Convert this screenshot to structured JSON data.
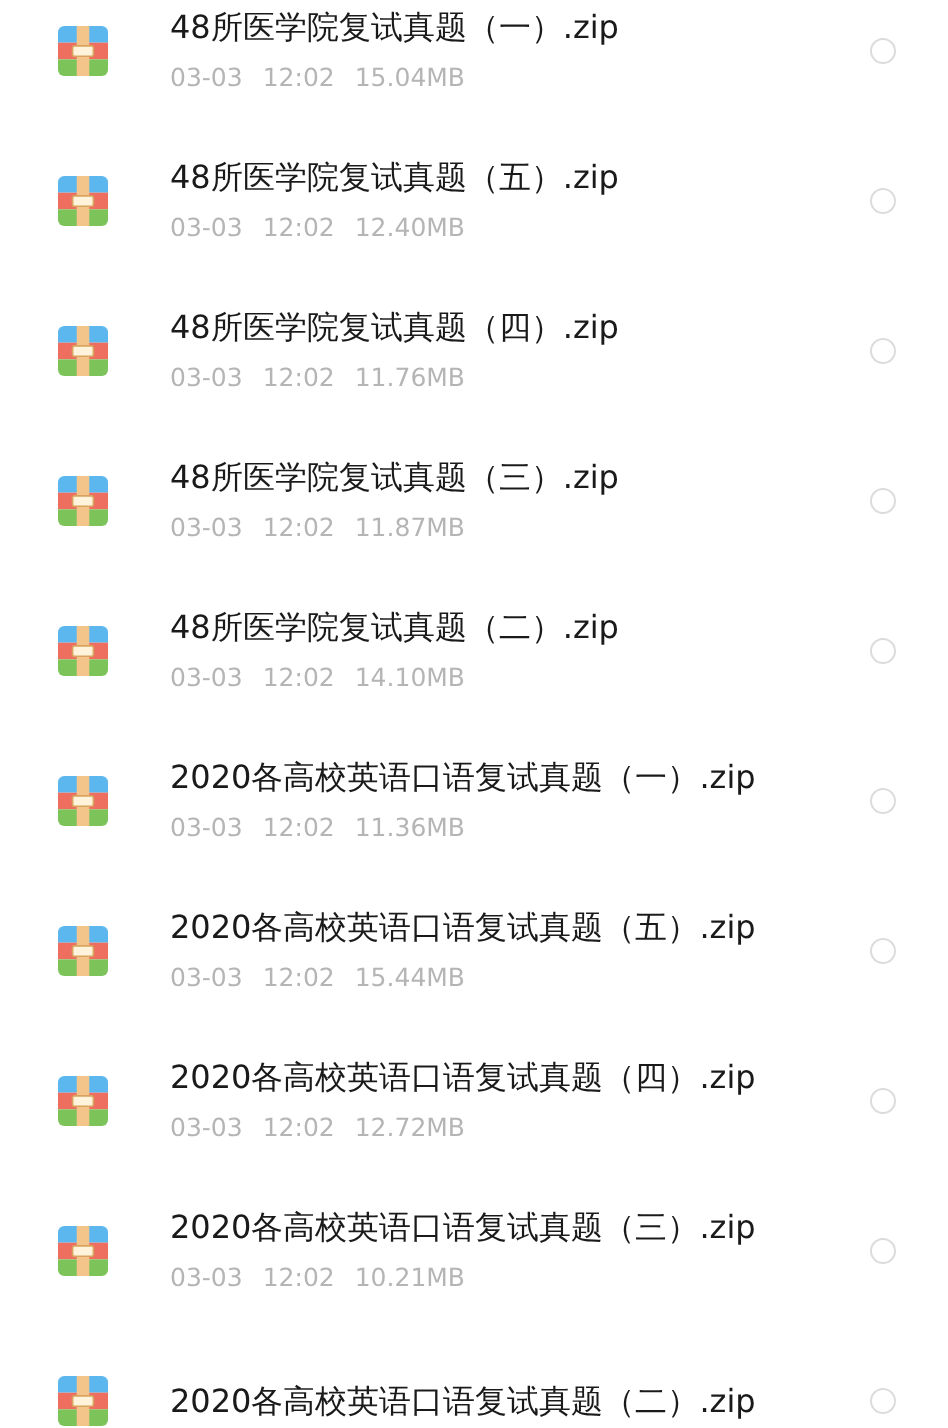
{
  "files": [
    {
      "name": "48所医学院复试真题（一）.zip",
      "date": "03-03",
      "time": "12:02",
      "size": "15.04MB",
      "selected": false
    },
    {
      "name": "48所医学院复试真题（五）.zip",
      "date": "03-03",
      "time": "12:02",
      "size": "12.40MB",
      "selected": false
    },
    {
      "name": "48所医学院复试真题（四）.zip",
      "date": "03-03",
      "time": "12:02",
      "size": "11.76MB",
      "selected": false
    },
    {
      "name": "48所医学院复试真题（三）.zip",
      "date": "03-03",
      "time": "12:02",
      "size": "11.87MB",
      "selected": false
    },
    {
      "name": "48所医学院复试真题（二）.zip",
      "date": "03-03",
      "time": "12:02",
      "size": "14.10MB",
      "selected": false
    },
    {
      "name": "2020各高校英语口语复试真题（一）.zip",
      "date": "03-03",
      "time": "12:02",
      "size": "11.36MB",
      "selected": false
    },
    {
      "name": "2020各高校英语口语复试真题（五）.zip",
      "date": "03-03",
      "time": "12:02",
      "size": "15.44MB",
      "selected": false
    },
    {
      "name": "2020各高校英语口语复试真题（四）.zip",
      "date": "03-03",
      "time": "12:02",
      "size": "12.72MB",
      "selected": false
    },
    {
      "name": "2020各高校英语口语复试真题（三）.zip",
      "date": "03-03",
      "time": "12:02",
      "size": "10.21MB",
      "selected": false
    },
    {
      "name": "2020各高校英语口语复试真题（二）.zip",
      "selected": false
    }
  ]
}
